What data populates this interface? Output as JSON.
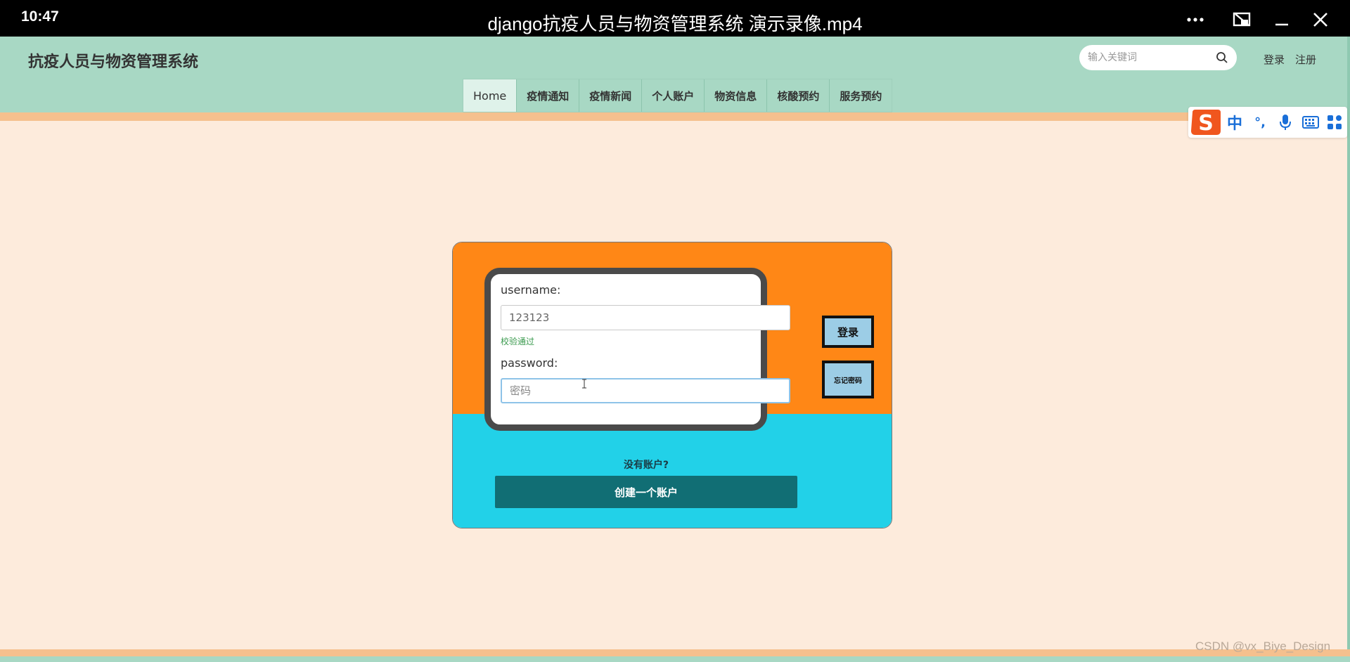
{
  "player": {
    "time": "10:47",
    "title": "django抗疫人员与物资管理系统 演示录像.mp4",
    "icons": [
      "more-icon",
      "screen-off-icon",
      "minimize-icon",
      "close-icon"
    ]
  },
  "header": {
    "site_title": "抗疫人员与物资管理系统",
    "search_placeholder": "输入关键词",
    "login_link": "登录",
    "register_link": "注册"
  },
  "nav": {
    "items": [
      "Home",
      "疫情通知",
      "疫情新闻",
      "个人账户",
      "物资信息",
      "核酸预约",
      "服务预约"
    ]
  },
  "ime": {
    "items": [
      "中",
      "°,"
    ]
  },
  "login": {
    "username_label": "username:",
    "username_value": "123123",
    "valid_message": "校验通过",
    "password_label": "password:",
    "password_placeholder": "密码",
    "login_button": "登录",
    "forgot_button": "忘记密码",
    "no_account": "没有账户?",
    "create_account": "创建一个账户"
  },
  "colors": {
    "header_bg": "#a8d8c4",
    "page_bg": "#fdebdc",
    "card_orange": "#ff8716",
    "card_cyan": "#22d1e8",
    "create_button": "#116e74",
    "side_button": "#9ccde6"
  },
  "watermark": "CSDN @vx_Biye_Design"
}
